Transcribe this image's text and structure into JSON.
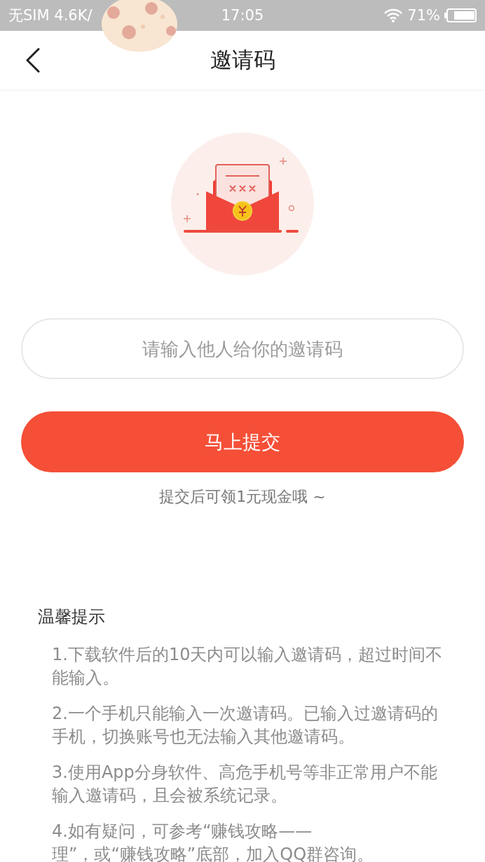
{
  "status_bar": {
    "carrier": "无SIM 4.6K/",
    "time": "17:05",
    "battery": "71%"
  },
  "header": {
    "title": "邀请码"
  },
  "invite_field": {
    "placeholder": "请输入他人给你的邀请码"
  },
  "submit_button": "马上提交",
  "reward_note": "提交后可领1元现金哦 ~",
  "tips": {
    "title": "温馨提示",
    "items": [
      {
        "lines": [
          "1.下载软件后的10天内可以输入邀请码，超过时间不能输入。"
        ]
      },
      {
        "lines": [
          "2.一个手机只能输入一次邀请码。已输入过邀请码的手机，切换账号也无法输入其他邀请码。"
        ]
      },
      {
        "lines": [
          "3.使用App分身软件、高危手机号等非正常用户不能输入邀请码，且会被系统记录。"
        ]
      },
      {
        "lines": [
          "4.如有疑问，可参考“赚钱攻略——",
          "理”，或“赚钱攻略”底部，加入QQ群咨询。"
        ]
      }
    ]
  }
}
